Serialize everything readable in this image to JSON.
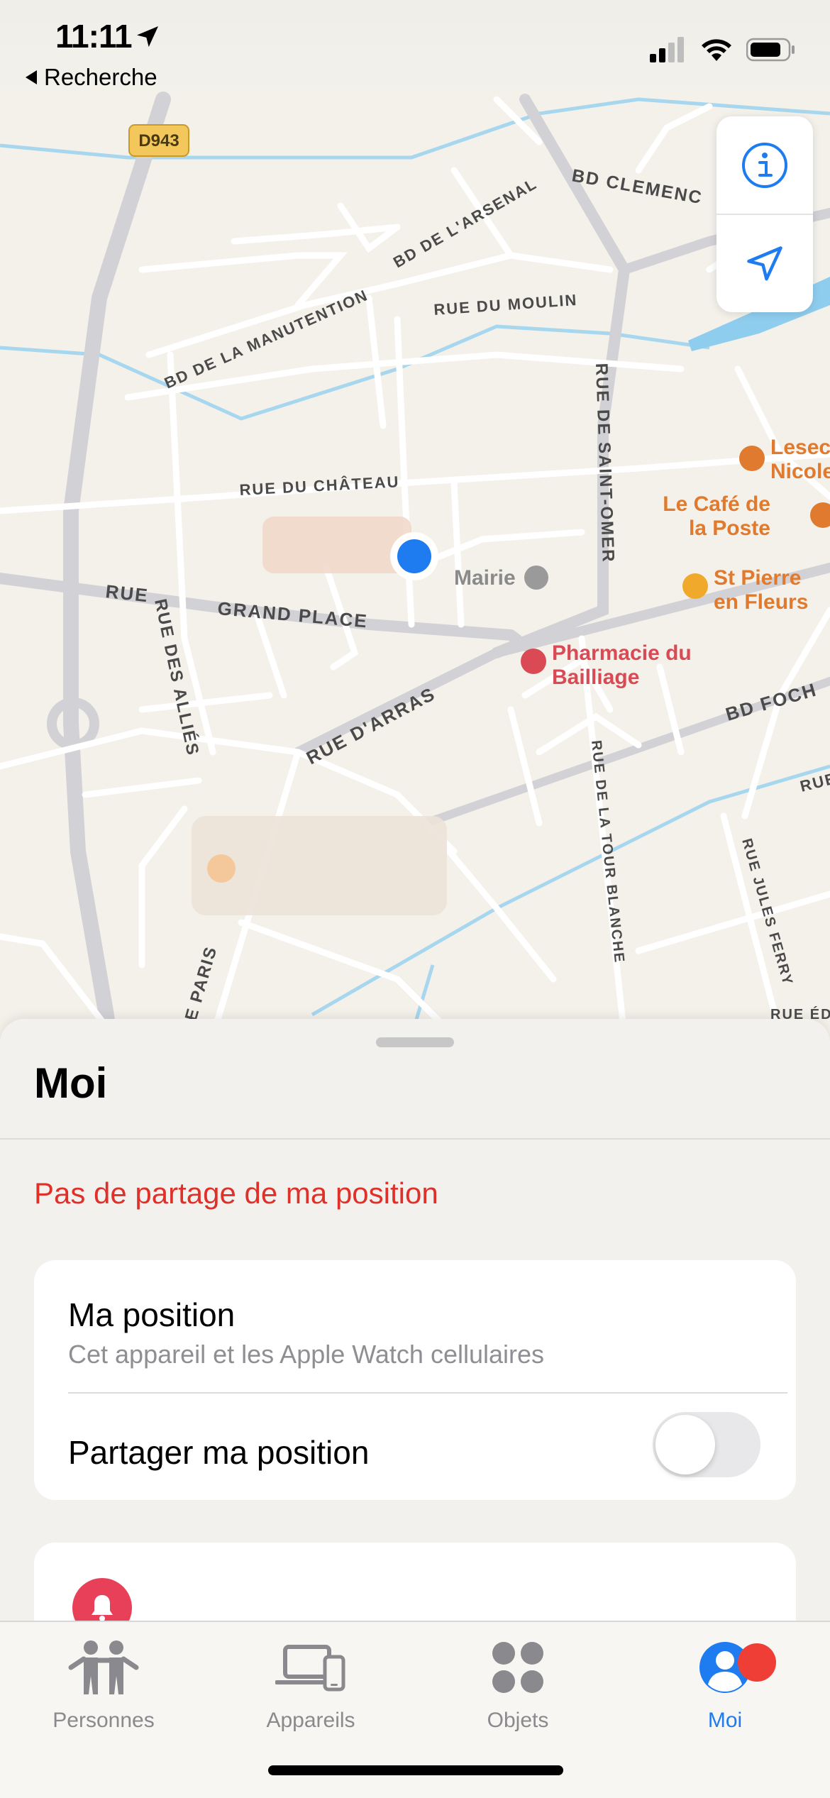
{
  "status_bar": {
    "time": "11:11",
    "back_label": "Recherche"
  },
  "map": {
    "road_shield": "D943",
    "streets": {
      "bd_clemenceau": "BD CLEMENC",
      "bd_arsenal": "BD DE L'ARSENAL",
      "bd_manutention": "BD DE LA MANUTENTION",
      "rue_moulin": "RUE DU MOULIN",
      "rue_saint_omer": "RUE DE SAINT-OMER",
      "rue_chateau": "RUE DU CHÂTEAU",
      "grand_place": "GRAND PLACE",
      "rue": "RUE",
      "rue_allies": "RUE DES ALLIÉS",
      "rue_arras": "RUE D'ARRAS",
      "bd_foch": "BD FOCH",
      "rue_tour_blanche": "RUE DE LA TOUR BLANCHE",
      "rue_jules_ferry": "RUE JULES FERRY",
      "rue_right": "RUE",
      "rue_ed": "RUE ÉD",
      "paris": "E PARIS"
    },
    "pois": {
      "lesec_line1": "Lesec",
      "lesec_line2": "Nicole",
      "cafe_line1": "Le Café de",
      "cafe_line2": "la Poste",
      "stpierre_line1": "St Pierre",
      "stpierre_line2": "en Fleurs",
      "mairie": "Mairie",
      "pharmacie_line1": "Pharmacie du",
      "pharmacie_line2": "Bailliage"
    },
    "colors": {
      "land": "#f3f1ea",
      "road": "#ffffff",
      "major_road": "#d3d2d6",
      "water": "#9fd3ef",
      "poi_orange": "#e07a2e",
      "poi_red": "#d94a55",
      "user_dot": "#1f7cf0"
    }
  },
  "sheet": {
    "title": "Moi",
    "warning": "Pas de partage de ma position",
    "card": {
      "title": "Ma position",
      "subtitle": "Cet appareil et les Apple Watch cellulaires",
      "row_label": "Partager ma position",
      "toggle_on": false
    }
  },
  "tabbar": {
    "tabs": [
      {
        "label": "Personnes",
        "icon": "people-icon",
        "active": false
      },
      {
        "label": "Appareils",
        "icon": "devices-icon",
        "active": false
      },
      {
        "label": "Objets",
        "icon": "items-icon",
        "active": false
      },
      {
        "label": "Moi",
        "icon": "person-circle-icon",
        "active": true
      }
    ]
  }
}
